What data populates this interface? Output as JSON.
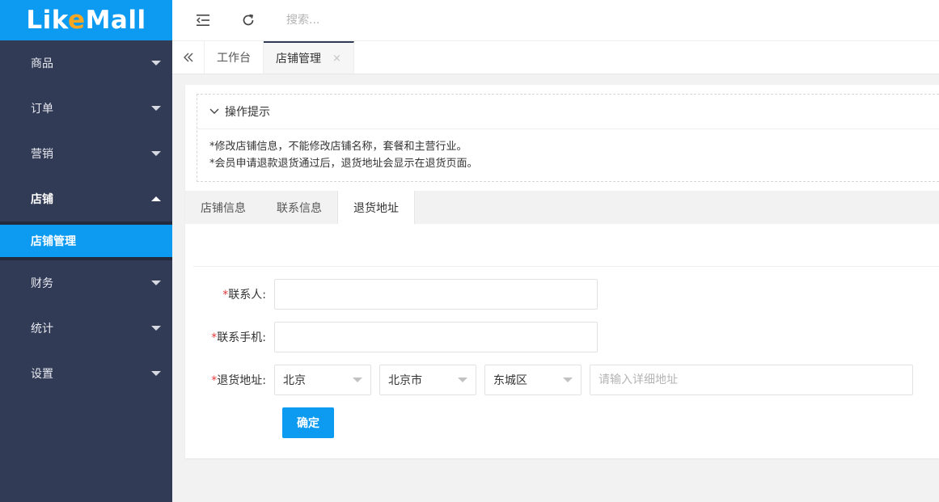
{
  "logo": {
    "part1": "Lik",
    "accent": "e",
    "part2": "Mall"
  },
  "sidebar": {
    "items": [
      {
        "label": "商品"
      },
      {
        "label": "订单"
      },
      {
        "label": "营销"
      },
      {
        "label": "店铺"
      },
      {
        "label": "财务"
      },
      {
        "label": "统计"
      },
      {
        "label": "设置"
      }
    ],
    "submenu": {
      "label": "店铺管理"
    }
  },
  "topbar": {
    "search_placeholder": "搜索..."
  },
  "tabs": {
    "items": [
      {
        "label": "工作台"
      },
      {
        "label": "店铺管理",
        "close": "×"
      }
    ]
  },
  "tips": {
    "title": "操作提示",
    "lines": [
      "*修改店铺信息，不能修改店铺名称，套餐和主营行业。",
      "*会员申请退款退货通过后，退货地址会显示在退货页面。"
    ]
  },
  "form_tabs": [
    {
      "label": "店铺信息"
    },
    {
      "label": "联系信息"
    },
    {
      "label": "退货地址"
    }
  ],
  "form": {
    "contact": {
      "star": "*",
      "label": "联系人:",
      "value": ""
    },
    "phone": {
      "star": "*",
      "label": "联系手机:",
      "value": ""
    },
    "address": {
      "star": "*",
      "label": "退货地址:",
      "province": "北京",
      "city": "北京市",
      "district": "东城区",
      "detail_placeholder": "请输入详细地址"
    },
    "confirm_label": "确定"
  },
  "colors": {
    "sidebar_bg": "#323b56",
    "brand_blue": "#0d9bf2",
    "logo_accent": "#f5a623",
    "required_red": "#e4393c"
  }
}
